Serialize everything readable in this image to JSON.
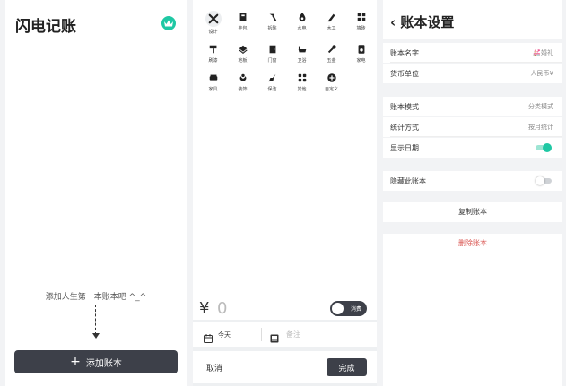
{
  "app": {
    "title": "闪电记账",
    "empty_hint": "添加人生第一本账本吧 ^_^",
    "add_button": "添加账本",
    "accent": "#1fc8a4"
  },
  "entry": {
    "categories": [
      {
        "label": "设计",
        "icon": "close-tools-icon",
        "selected": true
      },
      {
        "label": "丰包",
        "icon": "box-icon"
      },
      {
        "label": "拆除",
        "icon": "hammer-icon"
      },
      {
        "label": "水电",
        "icon": "drop-icon"
      },
      {
        "label": "木工",
        "icon": "pencil-icon"
      },
      {
        "label": "墙砖",
        "icon": "brick-icon"
      },
      {
        "label": "刷漆",
        "icon": "paint-roller-icon"
      },
      {
        "label": "地板",
        "icon": "layers-icon"
      },
      {
        "label": "门窗",
        "icon": "door-icon"
      },
      {
        "label": "卫浴",
        "icon": "bathtub-icon"
      },
      {
        "label": "五金",
        "icon": "wrench-icon"
      },
      {
        "label": "家电",
        "icon": "appliance-icon"
      },
      {
        "label": "家具",
        "icon": "sofa-icon"
      },
      {
        "label": "装饰",
        "icon": "plant-icon"
      },
      {
        "label": "保洁",
        "icon": "broom-icon"
      },
      {
        "label": "其他",
        "icon": "grid-icon"
      },
      {
        "label": "自定义",
        "icon": "plus-circle-icon"
      }
    ],
    "currency_symbol": "¥",
    "amount": "0",
    "type_toggle": "消费",
    "date_label": "今天",
    "note_placeholder": "备注",
    "cancel": "取消",
    "done": "完成"
  },
  "settings": {
    "title": "账本设置",
    "rows": [
      {
        "label": "账本名字",
        "value": "💒婚礼"
      },
      {
        "label": "货币单位",
        "value": "人民币¥"
      },
      {
        "label": "账本模式",
        "value": "分类模式"
      },
      {
        "label": "统计方式",
        "value": "按月统计"
      },
      {
        "label": "显示日期",
        "toggle": true
      },
      {
        "label": "隐藏此账本",
        "toggle": false
      }
    ],
    "copy": "复制账本",
    "delete": "删除账本",
    "danger_color": "#d9534f"
  }
}
